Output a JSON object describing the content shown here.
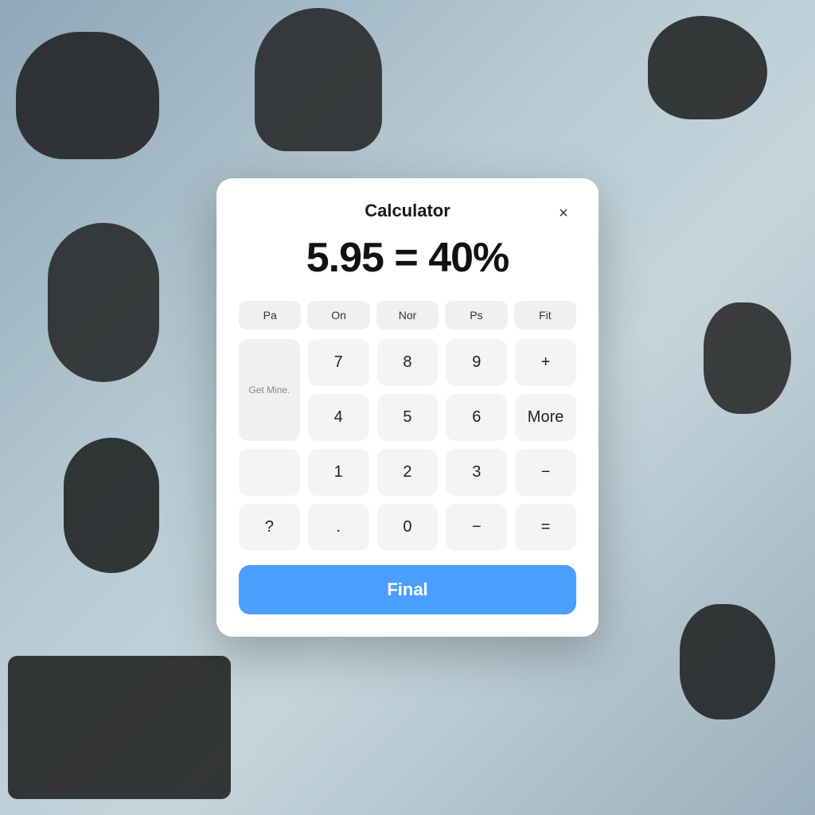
{
  "background": {
    "color": "#b8ccd4"
  },
  "calculator": {
    "title": "Calculator",
    "close_label": "×",
    "display_value": "5.95  =  40%",
    "modes": [
      {
        "id": "pa",
        "label": "Pa"
      },
      {
        "id": "on",
        "label": "On"
      },
      {
        "id": "nor",
        "label": "Nor"
      },
      {
        "id": "ps",
        "label": "Ps"
      },
      {
        "id": "fit",
        "label": "Fit"
      }
    ],
    "get_mine_label": "Get\nMine.",
    "buttons": [
      {
        "id": "7",
        "label": "7"
      },
      {
        "id": "8",
        "label": "8"
      },
      {
        "id": "9",
        "label": "9"
      },
      {
        "id": "plus",
        "label": "+"
      },
      {
        "id": "4",
        "label": "4"
      },
      {
        "id": "5",
        "label": "5"
      },
      {
        "id": "6",
        "label": "6"
      },
      {
        "id": "more",
        "label": "More"
      },
      {
        "id": "1",
        "label": "1"
      },
      {
        "id": "2",
        "label": "2"
      },
      {
        "id": "3",
        "label": "3"
      },
      {
        "id": "minus2",
        "label": "−"
      },
      {
        "id": "question",
        "label": "?"
      },
      {
        "id": "dot",
        "label": "."
      },
      {
        "id": "0",
        "label": "0"
      },
      {
        "id": "minus",
        "label": "−"
      },
      {
        "id": "equals",
        "label": "="
      }
    ],
    "final_label": "Final"
  }
}
